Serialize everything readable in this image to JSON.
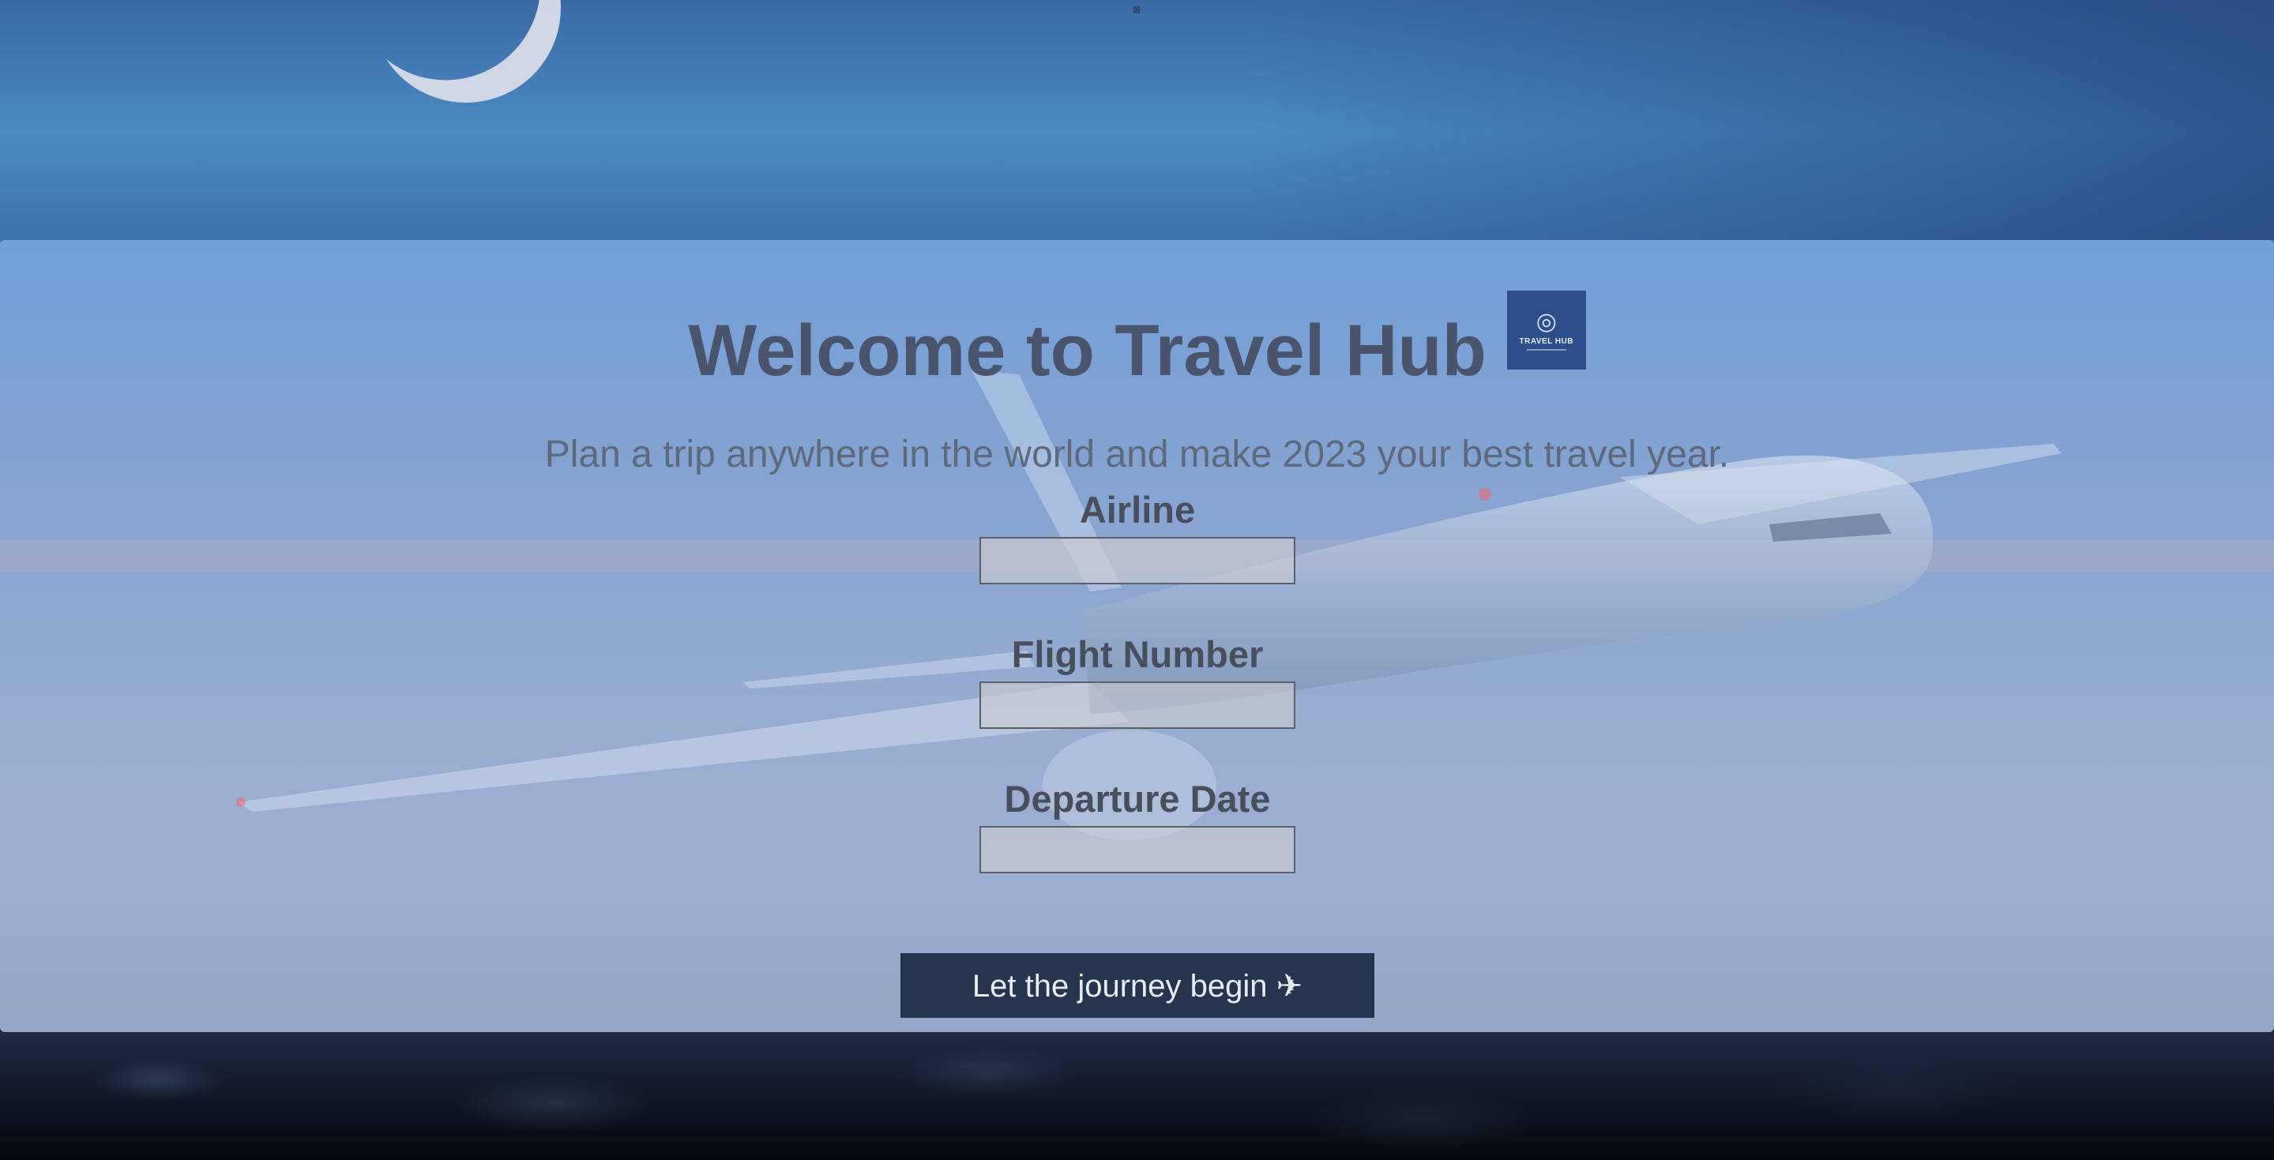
{
  "hero": {
    "title": "Welcome to Travel Hub",
    "subtitle": "Plan a trip anywhere in the world and make 2023 your best travel year.",
    "logo": {
      "icon": "globe-icon",
      "text": "TRAVEL HUB"
    }
  },
  "form": {
    "fields": [
      {
        "label": "Airline",
        "value": "",
        "placeholder": ""
      },
      {
        "label": "Flight Number",
        "value": "",
        "placeholder": ""
      },
      {
        "label": "Departure Date",
        "value": "",
        "placeholder": ""
      }
    ],
    "submit_label": "Let the journey begin ✈"
  },
  "top_marker": "⊠",
  "colors": {
    "panel_overlay": "#7aa3d8",
    "title_text": "#48556a",
    "subtitle_text": "#5d6a7c",
    "button_bg": "#253550",
    "logo_bg": "#2c4f8c"
  }
}
